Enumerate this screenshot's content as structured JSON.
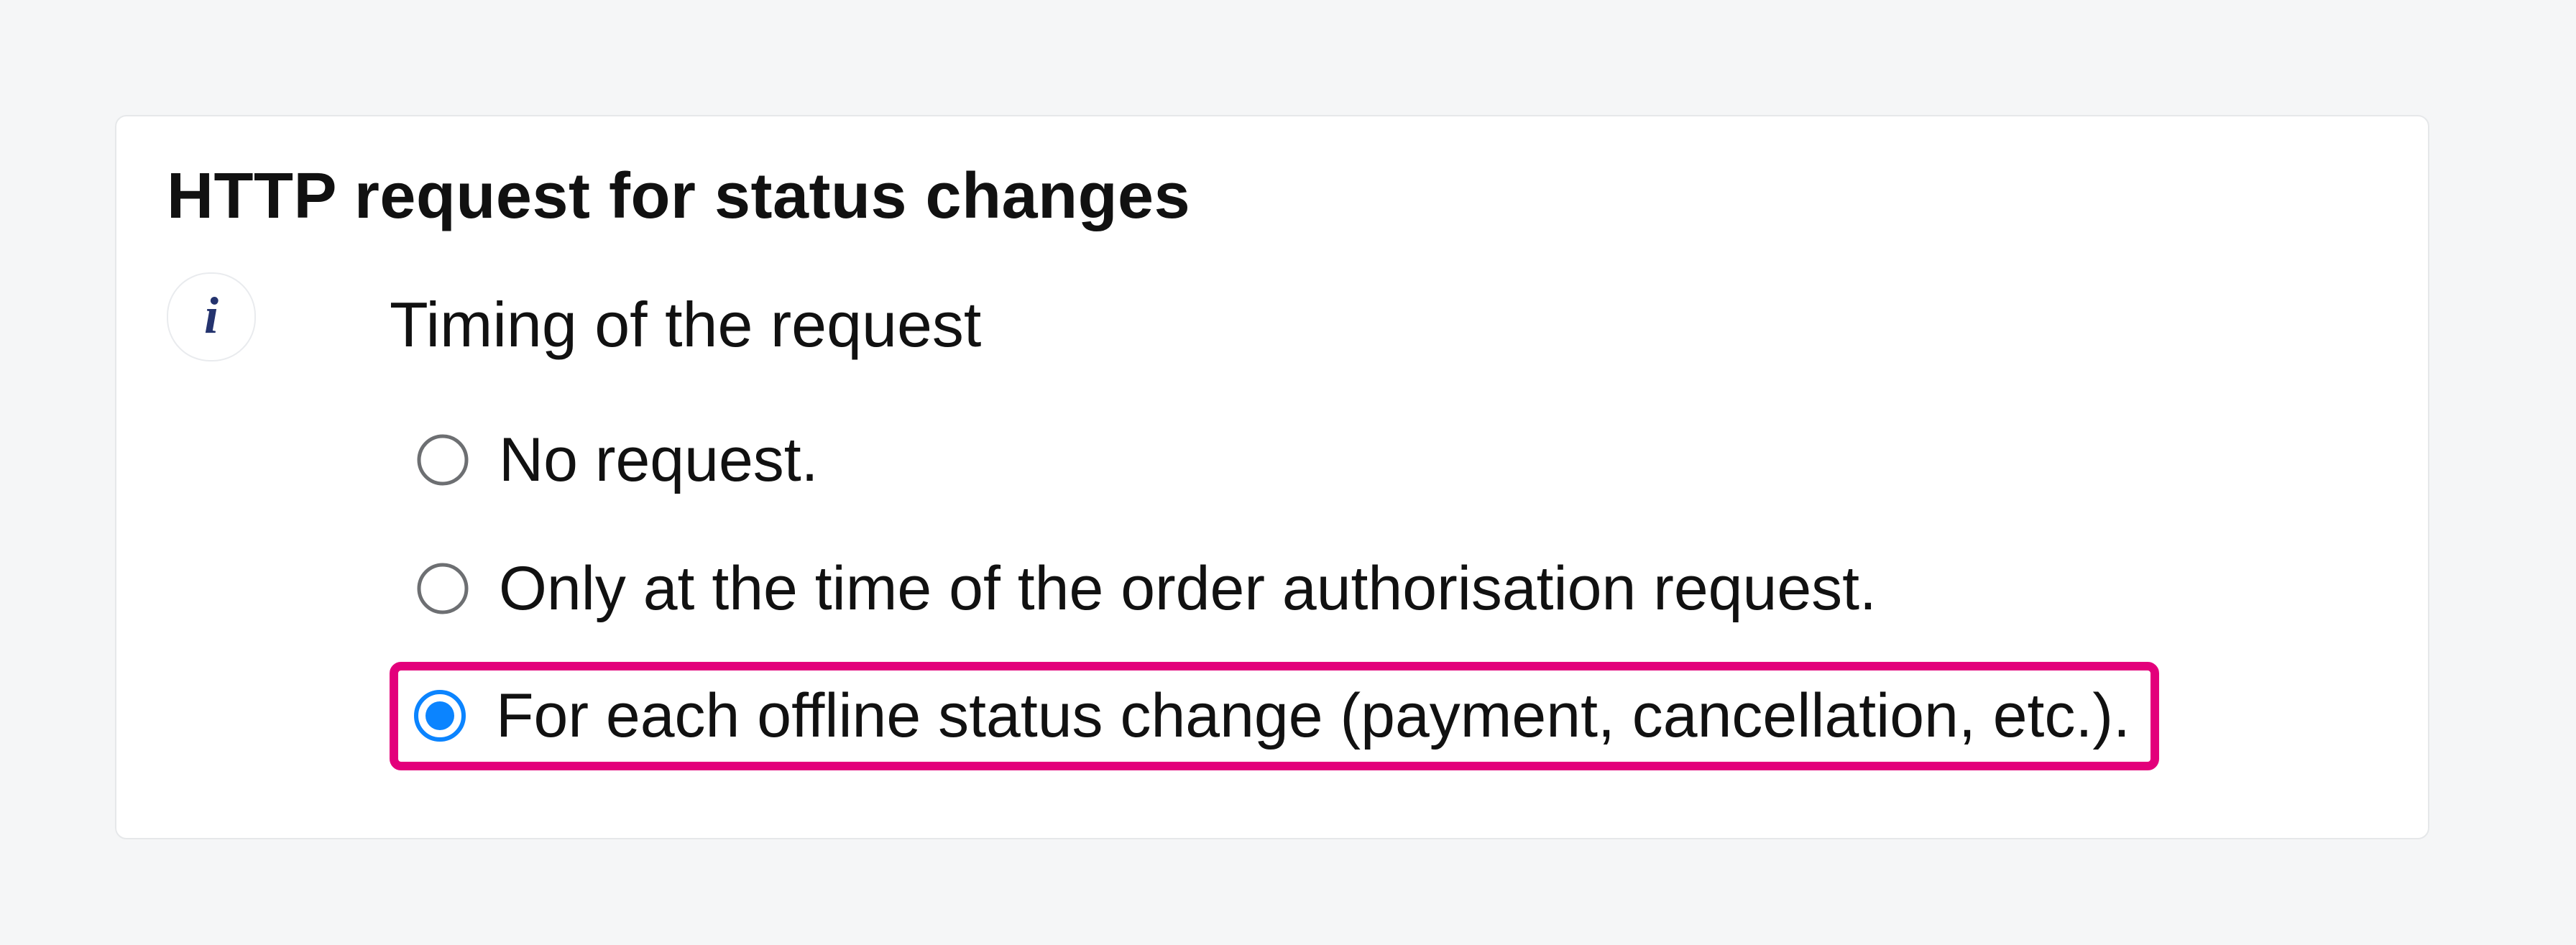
{
  "panel": {
    "title": "HTTP request for status changes",
    "sub_label": "Timing of the request",
    "options": [
      {
        "label": "No request.",
        "selected": false,
        "highlight": false
      },
      {
        "label": "Only at the time of the order authorisation request.",
        "selected": false,
        "highlight": false
      },
      {
        "label": "For each offline status change (payment, cancellation, etc.).",
        "selected": true,
        "highlight": true
      }
    ]
  },
  "icons": {
    "info_glyph": "i"
  }
}
